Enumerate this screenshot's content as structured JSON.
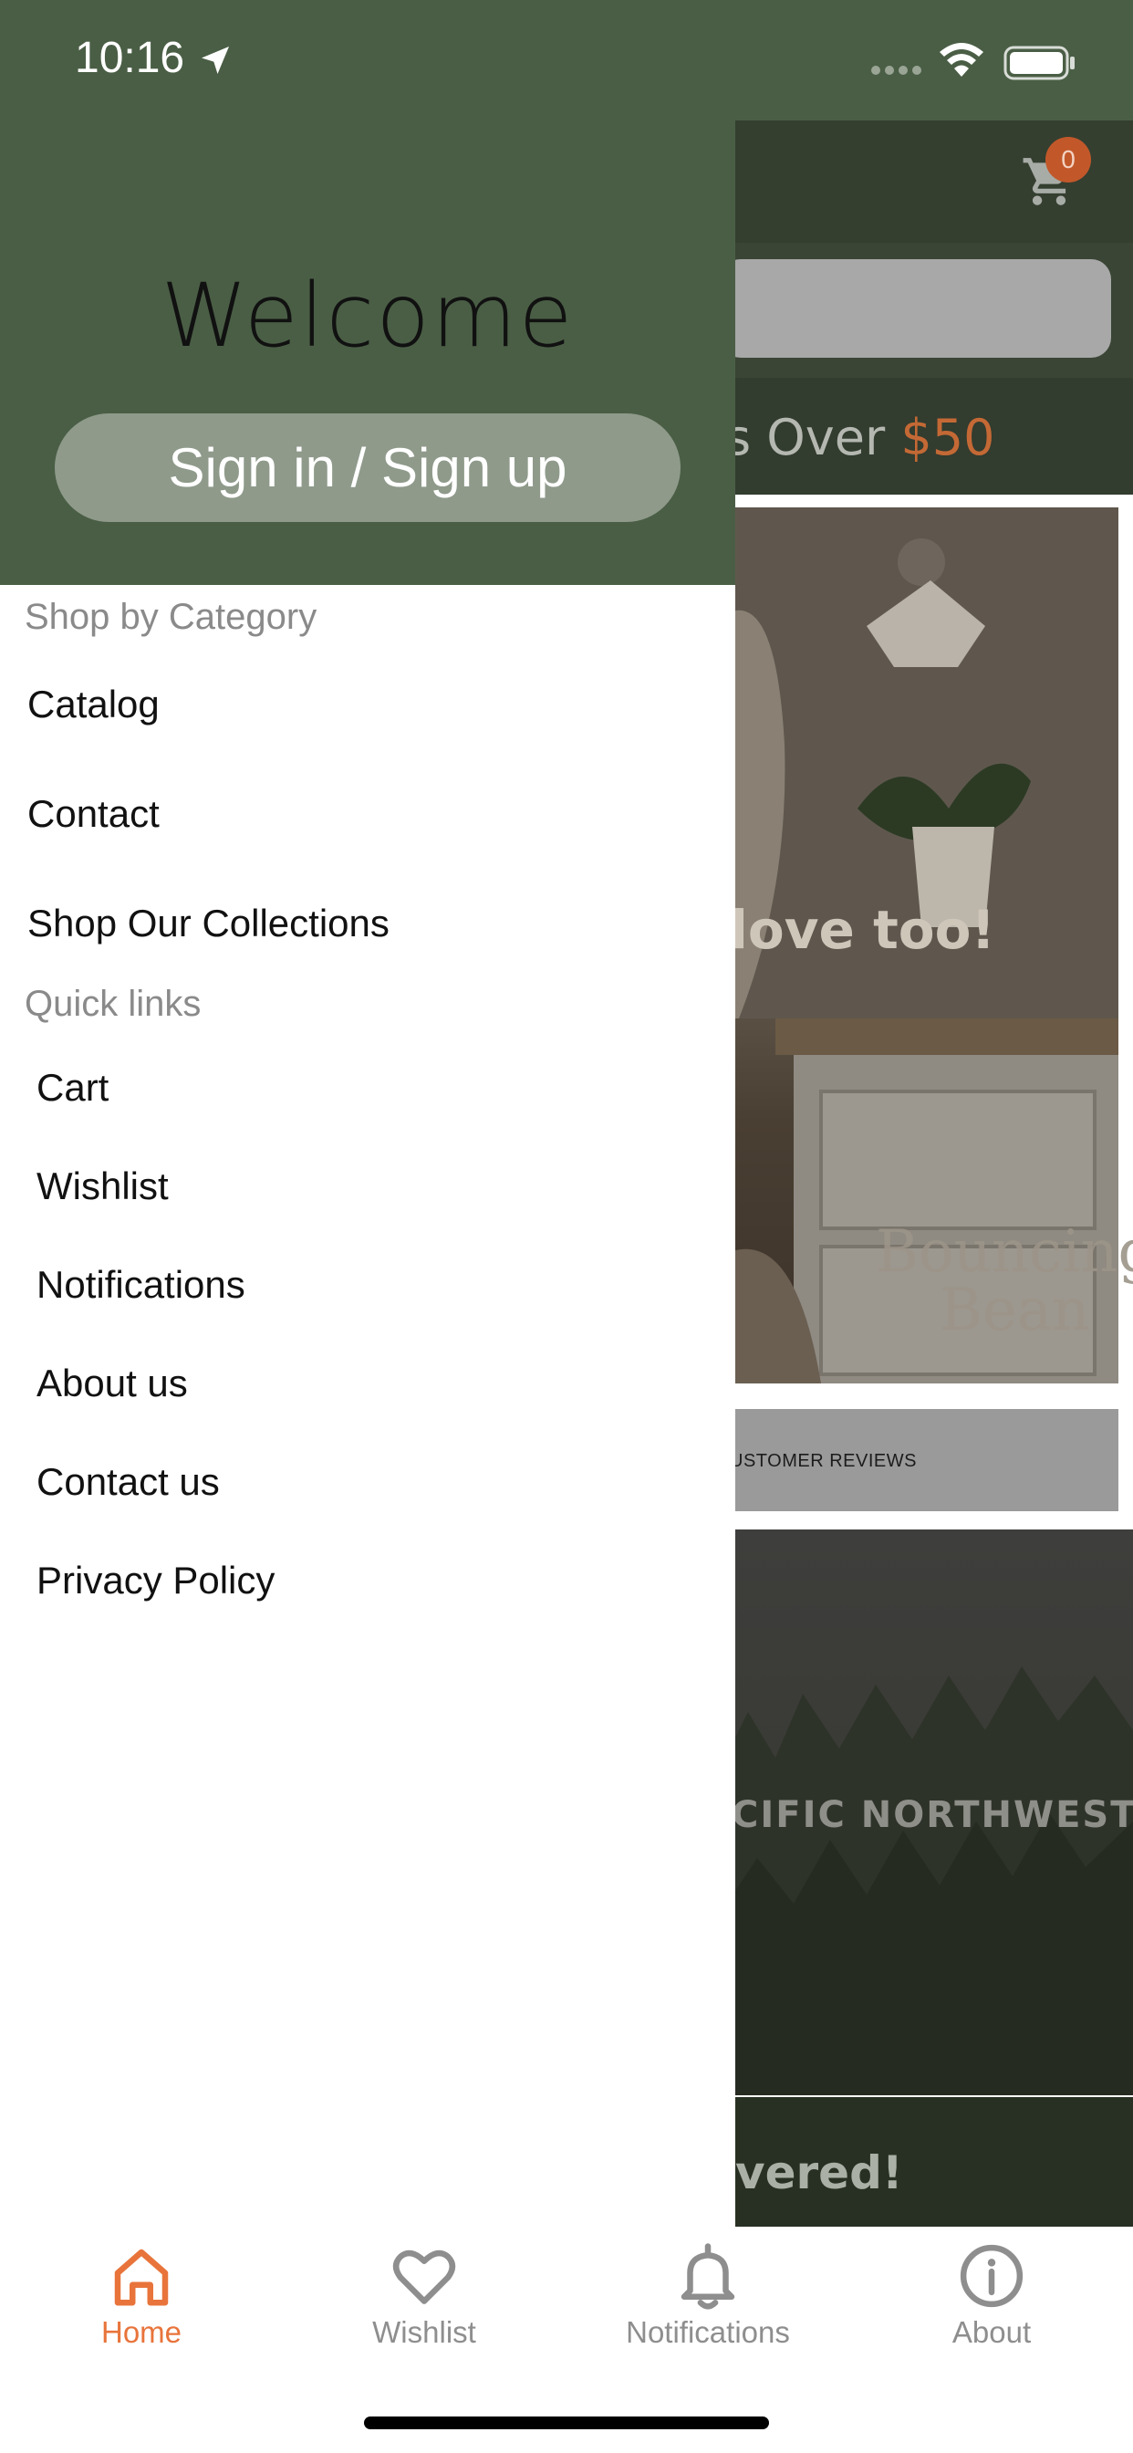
{
  "status_bar": {
    "time": "10:16"
  },
  "header": {
    "cart_count": "0"
  },
  "background": {
    "promo_prefix": "s Over ",
    "promo_amount": "$50",
    "hero_text": "love too!",
    "hero_watermark_line1": "Bouncing",
    "hero_watermark_line2": "Bean",
    "reviews_text": "USTOMER REVIEWS",
    "banner_text": "CIFIC NORTHWEST!",
    "bottom_text": "vered!"
  },
  "drawer": {
    "welcome": "Welcome",
    "signin_label": "Sign in / Sign up",
    "categories_title": "Shop by Category",
    "categories": [
      "Catalog",
      "Contact",
      "Shop Our Collections"
    ],
    "quick_links_title": "Quick links",
    "quick_links": [
      "Cart",
      "Wishlist",
      "Notifications",
      "About us",
      "Contact us",
      "Privacy Policy"
    ]
  },
  "tabs": [
    {
      "label": "Home",
      "icon": "home-icon",
      "active": true
    },
    {
      "label": "Wishlist",
      "icon": "heart-icon",
      "active": false
    },
    {
      "label": "Notifications",
      "icon": "bell-icon",
      "active": false
    },
    {
      "label": "About",
      "icon": "info-icon",
      "active": false
    }
  ],
  "colors": {
    "accent": "#e8743b",
    "drawer_header": "#4a5e45",
    "inactive_tab": "#8e8e8e"
  }
}
